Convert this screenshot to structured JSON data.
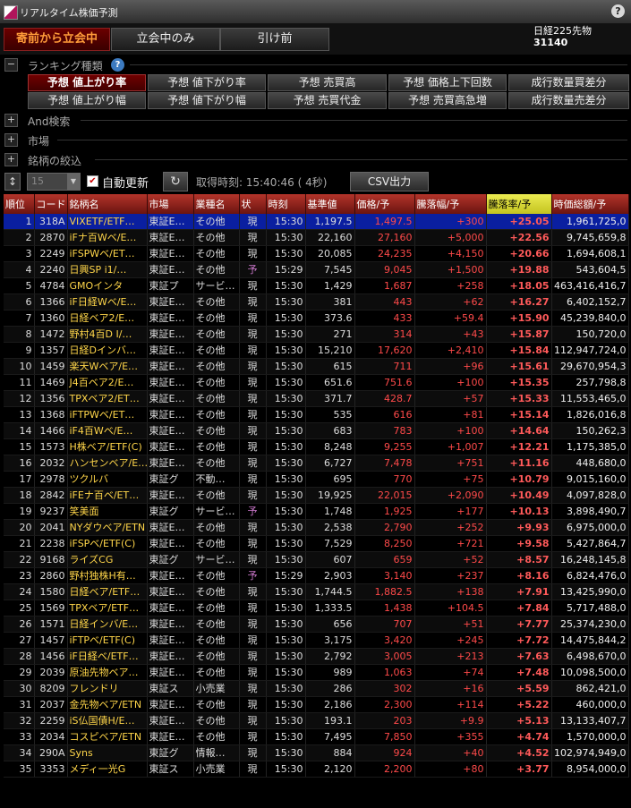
{
  "window": {
    "title": "リアルタイム株価予測",
    "help": "?",
    "close": "×"
  },
  "modes": [
    "寄前から立会中",
    "立会中のみ",
    "引け前"
  ],
  "nikkei": {
    "label": "日経225先物",
    "value": "31140"
  },
  "ranking_section": {
    "toggle": "−",
    "label": "ランキング種類",
    "help": "?"
  },
  "ranking_buttons": [
    [
      "予想 値上がり率",
      "予想 値下がり率",
      "予想 売買高",
      "予想 価格上下回数",
      "成行数量買差分"
    ],
    [
      "予想 値上がり幅",
      "予想 値下がり幅",
      "予想 売買代金",
      "予想 売買高急増",
      "成行数量売差分"
    ]
  ],
  "sections": [
    {
      "toggle": "+",
      "label": "And検索"
    },
    {
      "toggle": "+",
      "label": "市場"
    },
    {
      "toggle": "+",
      "label": "銘柄の絞込"
    }
  ],
  "controls": {
    "sort_icon": "↕",
    "count": "15",
    "auto_update_checked": "✔",
    "auto_update_label": "自動更新",
    "refresh_icon": "↻",
    "time_info": "取得時刻: 15:40:46 ( 4秒)",
    "csv_label": "CSV出力"
  },
  "columns": [
    "順位",
    "コード",
    "銘柄名",
    "市場",
    "業種名",
    "状",
    "時刻",
    "基準値",
    "価格/予",
    "騰落幅/予",
    "騰落率/予",
    "時価総額/予"
  ],
  "rows": [
    [
      "1",
      "318A",
      "VIXETF/ETF…",
      "東証E…",
      "その他",
      "現",
      "15:30",
      "1,197.5",
      "1,497.5",
      "+300",
      "+25.05",
      "1,961,725,0"
    ],
    [
      "2",
      "2870",
      "iFナ百Wベ/E…",
      "東証E…",
      "その他",
      "現",
      "15:30",
      "22,160",
      "27,160",
      "+5,000",
      "+22.56",
      "9,745,659,8"
    ],
    [
      "3",
      "2249",
      "iFSPWベ/ET…",
      "東証E…",
      "その他",
      "現",
      "15:30",
      "20,085",
      "24,235",
      "+4,150",
      "+20.66",
      "1,694,608,1"
    ],
    [
      "4",
      "2240",
      "日興SP i1/…",
      "東証E…",
      "その他",
      "予",
      "15:29",
      "7,545",
      "9,045",
      "+1,500",
      "+19.88",
      "543,604,5"
    ],
    [
      "5",
      "4784",
      "GMOインタ",
      "東証プ",
      "サービ…",
      "現",
      "15:30",
      "1,429",
      "1,687",
      "+258",
      "+18.05",
      "463,416,416,7"
    ],
    [
      "6",
      "1366",
      "iF日経Wベ/E…",
      "東証E…",
      "その他",
      "現",
      "15:30",
      "381",
      "443",
      "+62",
      "+16.27",
      "6,402,152,7"
    ],
    [
      "7",
      "1360",
      "日経ベア2/E…",
      "東証E…",
      "その他",
      "現",
      "15:30",
      "373.6",
      "433",
      "+59.4",
      "+15.90",
      "45,239,840,0"
    ],
    [
      "8",
      "1472",
      "野村4百D I/…",
      "東証E…",
      "その他",
      "現",
      "15:30",
      "271",
      "314",
      "+43",
      "+15.87",
      "150,720,0"
    ],
    [
      "9",
      "1357",
      "日経Dインバ…",
      "東証E…",
      "その他",
      "現",
      "15:30",
      "15,210",
      "17,620",
      "+2,410",
      "+15.84",
      "112,947,724,0"
    ],
    [
      "10",
      "1459",
      "楽天Wベア/E…",
      "東証E…",
      "その他",
      "現",
      "15:30",
      "615",
      "711",
      "+96",
      "+15.61",
      "29,670,954,3"
    ],
    [
      "11",
      "1469",
      "J4百ベア2/E…",
      "東証E…",
      "その他",
      "現",
      "15:30",
      "651.6",
      "751.6",
      "+100",
      "+15.35",
      "257,798,8"
    ],
    [
      "12",
      "1356",
      "TPXベア2/ET…",
      "東証E…",
      "その他",
      "現",
      "15:30",
      "371.7",
      "428.7",
      "+57",
      "+15.33",
      "11,553,465,0"
    ],
    [
      "13",
      "1368",
      "iFTPWベ/ET…",
      "東証E…",
      "その他",
      "現",
      "15:30",
      "535",
      "616",
      "+81",
      "+15.14",
      "1,826,016,8"
    ],
    [
      "14",
      "1466",
      "iF4百Wベ/E…",
      "東証E…",
      "その他",
      "現",
      "15:30",
      "683",
      "783",
      "+100",
      "+14.64",
      "150,262,3"
    ],
    [
      "15",
      "1573",
      "H株ベア/ETF(C)",
      "東証E…",
      "その他",
      "現",
      "15:30",
      "8,248",
      "9,255",
      "+1,007",
      "+12.21",
      "1,175,385,0"
    ],
    [
      "16",
      "2032",
      "ハンセンベア/E…",
      "東証E…",
      "その他",
      "現",
      "15:30",
      "6,727",
      "7,478",
      "+751",
      "+11.16",
      "448,680,0"
    ],
    [
      "17",
      "2978",
      "ツクルバ",
      "東証グ",
      "不動…",
      "現",
      "15:30",
      "695",
      "770",
      "+75",
      "+10.79",
      "9,015,160,0"
    ],
    [
      "18",
      "2842",
      "iFEナ百ベ/ET…",
      "東証E…",
      "その他",
      "現",
      "15:30",
      "19,925",
      "22,015",
      "+2,090",
      "+10.49",
      "4,097,828,0"
    ],
    [
      "19",
      "9237",
      "笑美面",
      "東証グ",
      "サービ…",
      "予",
      "15:30",
      "1,748",
      "1,925",
      "+177",
      "+10.13",
      "3,898,490,7"
    ],
    [
      "20",
      "2041",
      "NYダウベア/ETN",
      "東証E…",
      "その他",
      "現",
      "15:30",
      "2,538",
      "2,790",
      "+252",
      "+9.93",
      "6,975,000,0"
    ],
    [
      "21",
      "2238",
      "iFSPベ/ETF(C)",
      "東証E…",
      "その他",
      "現",
      "15:30",
      "7,529",
      "8,250",
      "+721",
      "+9.58",
      "5,427,864,7"
    ],
    [
      "22",
      "9168",
      "ライズCG",
      "東証グ",
      "サービ…",
      "現",
      "15:30",
      "607",
      "659",
      "+52",
      "+8.57",
      "16,248,145,8"
    ],
    [
      "23",
      "2860",
      "野村独株H有…",
      "東証E…",
      "その他",
      "予",
      "15:29",
      "2,903",
      "3,140",
      "+237",
      "+8.16",
      "6,824,476,0"
    ],
    [
      "24",
      "1580",
      "日経ベア/ETF…",
      "東証E…",
      "その他",
      "現",
      "15:30",
      "1,744.5",
      "1,882.5",
      "+138",
      "+7.91",
      "13,425,990,0"
    ],
    [
      "25",
      "1569",
      "TPXベア/ETF…",
      "東証E…",
      "その他",
      "現",
      "15:30",
      "1,333.5",
      "1,438",
      "+104.5",
      "+7.84",
      "5,717,488,0"
    ],
    [
      "26",
      "1571",
      "日経インバ/E…",
      "東証E…",
      "その他",
      "現",
      "15:30",
      "656",
      "707",
      "+51",
      "+7.77",
      "25,374,230,0"
    ],
    [
      "27",
      "1457",
      "iFTPベ/ETF(C)",
      "東証E…",
      "その他",
      "現",
      "15:30",
      "3,175",
      "3,420",
      "+245",
      "+7.72",
      "14,475,844,2"
    ],
    [
      "28",
      "1456",
      "iF日経ベ/ETF…",
      "東証E…",
      "その他",
      "現",
      "15:30",
      "2,792",
      "3,005",
      "+213",
      "+7.63",
      "6,498,670,0"
    ],
    [
      "29",
      "2039",
      "原油先物ベア…",
      "東証E…",
      "その他",
      "現",
      "15:30",
      "989",
      "1,063",
      "+74",
      "+7.48",
      "10,098,500,0"
    ],
    [
      "30",
      "8209",
      "フレンドリ",
      "東証ス",
      "小売業",
      "現",
      "15:30",
      "286",
      "302",
      "+16",
      "+5.59",
      "862,421,0"
    ],
    [
      "31",
      "2037",
      "金先物ベア/ETN",
      "東証E…",
      "その他",
      "現",
      "15:30",
      "2,186",
      "2,300",
      "+114",
      "+5.22",
      "460,000,0"
    ],
    [
      "32",
      "2259",
      "iS仏国債H/E…",
      "東証E…",
      "その他",
      "現",
      "15:30",
      "193.1",
      "203",
      "+9.9",
      "+5.13",
      "13,133,407,7"
    ],
    [
      "33",
      "2034",
      "コスピベア/ETN",
      "東証E…",
      "その他",
      "現",
      "15:30",
      "7,495",
      "7,850",
      "+355",
      "+4.74",
      "1,570,000,0"
    ],
    [
      "34",
      "290A",
      "Syns",
      "東証グ",
      "情報…",
      "現",
      "15:30",
      "884",
      "924",
      "+40",
      "+4.52",
      "102,974,949,0"
    ],
    [
      "35",
      "3353",
      "メディ一光G",
      "東証ス",
      "小売業",
      "現",
      "15:30",
      "2,120",
      "2,200",
      "+80",
      "+3.77",
      "8,954,000,0"
    ]
  ]
}
